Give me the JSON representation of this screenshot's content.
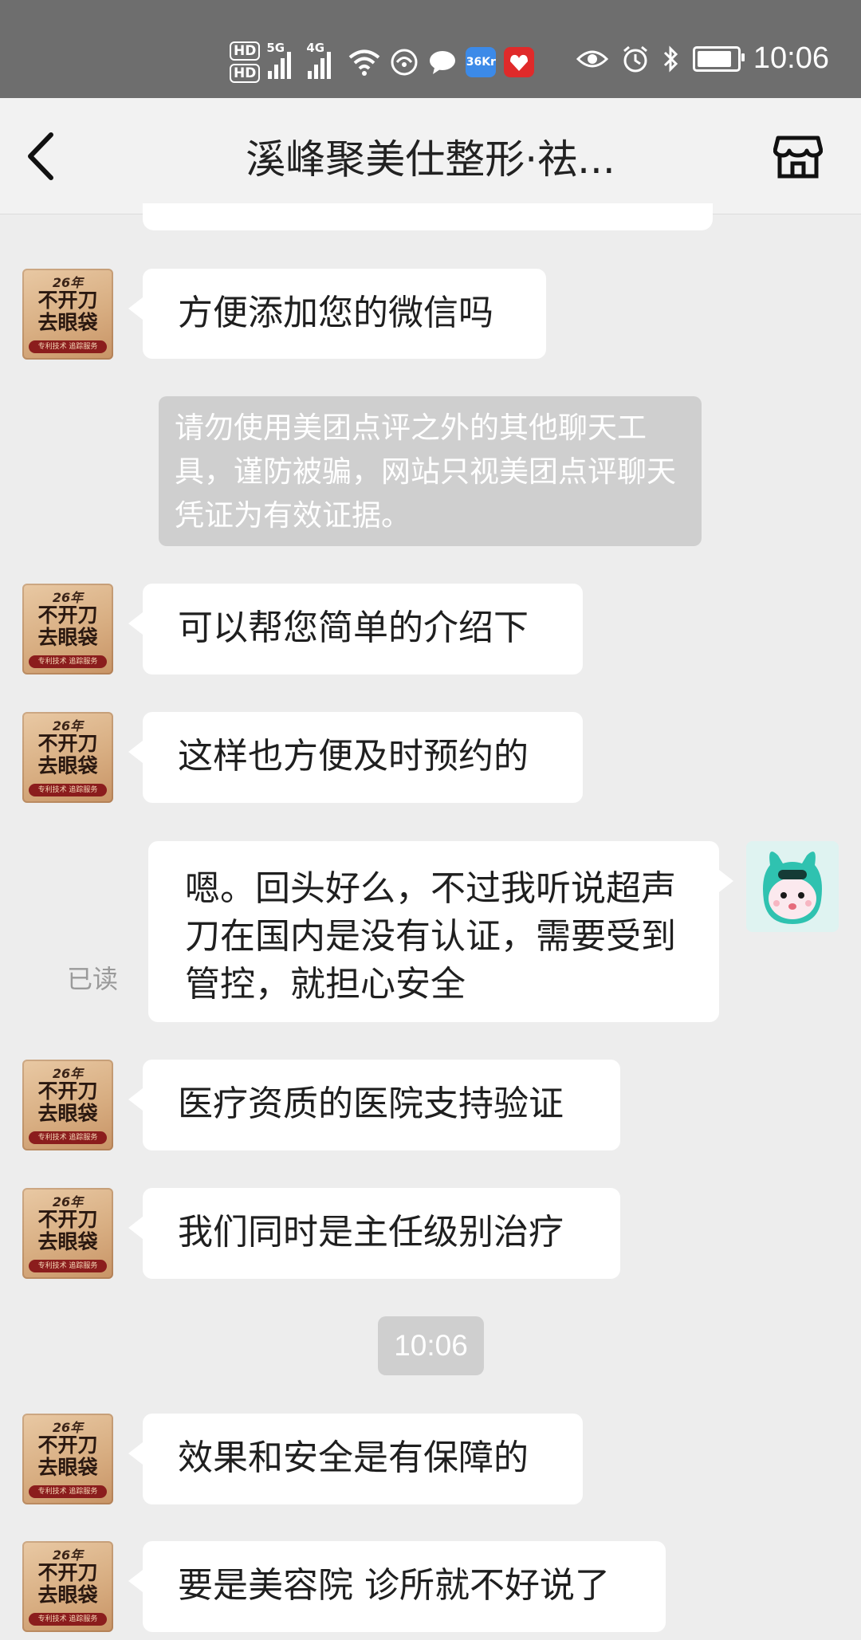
{
  "status_bar": {
    "hd1": "HD",
    "hd2": "HD",
    "net1": "5G",
    "net2": "4G",
    "app_36kr": "36Kr",
    "time": "10:06",
    "icons": [
      "eye-icon",
      "alarm-icon",
      "bluetooth-icon",
      "battery-icon"
    ]
  },
  "header": {
    "title": "溪峰聚美仕整形·祛..."
  },
  "avatar_store": {
    "year": "26年",
    "line1": "不开刀",
    "line2": "去眼袋",
    "strip": "专利技术 追踪服务"
  },
  "messages": {
    "m1": "方便添加您的微信吗",
    "system_notice": "请勿使用美团点评之外的其他聊天工具，谨防被骗，网站只视美团点评聊天凭证为有效证据。",
    "m2": "可以帮您简单的介绍下",
    "m3": "这样也方便及时预约的",
    "mine": "嗯。回头好么，不过我听说超声刀在国内是没有认证，需要受到管控，就担心安全",
    "read_label": "已读",
    "m4": "医疗资质的医院支持验证",
    "m5": "我们同时是主任级别治疗",
    "timestamp": "10:06",
    "m6": "效果和安全是有保障的",
    "m7": "要是美容院 诊所就不好说了"
  }
}
